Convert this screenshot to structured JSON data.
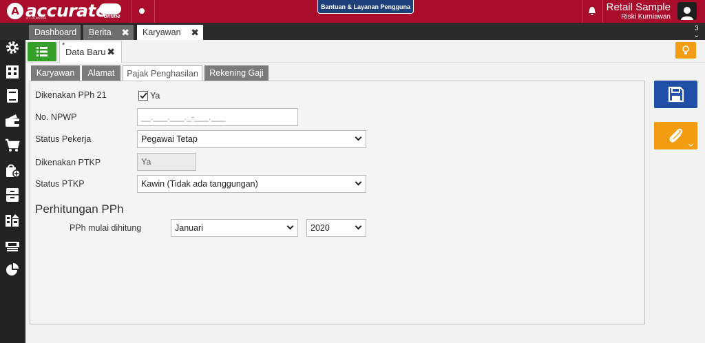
{
  "app": {
    "logo_text": "accurate",
    "logo_mark": "A",
    "logo_suffix": "online",
    "version": "v 1.0.0#9104",
    "help_label": "Bantuan & Layanan Pengguna",
    "company_name": "Retail Sample",
    "user_name": "Riski Kurniawan",
    "accent": "#a90d2b"
  },
  "tabs": [
    {
      "label": "Dashboard"
    },
    {
      "label": "Berita"
    },
    {
      "label": "Karyawan"
    }
  ],
  "tab_count": "3",
  "sidebar_icons": [
    "settings-icon",
    "building-icon",
    "ledger-icon",
    "wallet-icon",
    "cart-icon",
    "shopping-bag-icon",
    "archive-icon",
    "warehouse-icon",
    "tax-icon",
    "pie-chart-icon"
  ],
  "document": {
    "tab_label": "Data Baru",
    "dirty_marker": "*"
  },
  "subtabs": [
    {
      "label": "Karyawan"
    },
    {
      "label": "Alamat"
    },
    {
      "label": "Pajak Penghasilan"
    },
    {
      "label": "Rekening Gaji"
    }
  ],
  "form": {
    "pph21_label": "Dikenakan PPh 21",
    "pph21_check_label": "Ya",
    "pph21_checked": true,
    "npwp_label": "No. NPWP",
    "npwp_placeholder": "__.___.___._-___.___",
    "status_pekerja_label": "Status Pekerja",
    "status_pekerja_value": "Pegawai Tetap",
    "ptkp_label": "Dikenakan PTKP",
    "ptkp_value": "Ya",
    "status_ptkp_label": "Status PTKP",
    "status_ptkp_value": "Kawin (Tidak ada tanggungan)"
  },
  "perhitungan": {
    "title": "Perhitungan PPh",
    "start_label": "PPh mulai dihitung",
    "month_value": "Januari",
    "year_value": "2020"
  }
}
